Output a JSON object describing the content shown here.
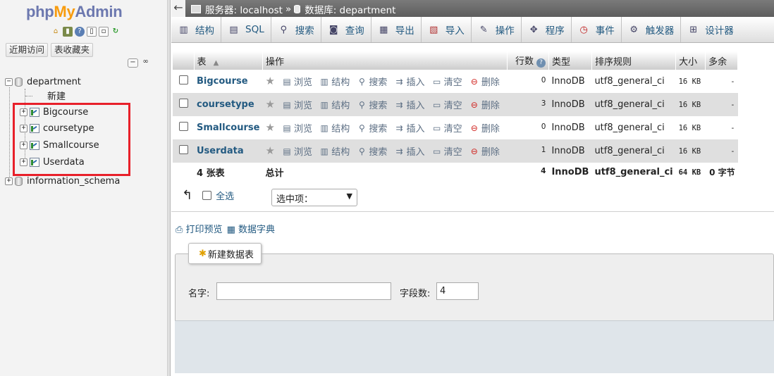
{
  "logo": {
    "php": "php",
    "my": "My",
    "admin": "Admin"
  },
  "sidebar": {
    "tab_recent": "近期访问",
    "tab_favorites": "表收藏夹",
    "tree": {
      "db1": "department",
      "new": "新建",
      "tables": [
        "Bigcourse",
        "coursetype",
        "Smallcourse",
        "Userdata"
      ],
      "db2": "information_schema"
    }
  },
  "breadcrumb": {
    "server": "服务器: localhost",
    "sep": "»",
    "database": "数据库: department"
  },
  "tabs": [
    "结构",
    "SQL",
    "搜索",
    "查询",
    "导出",
    "导入",
    "操作",
    "程序",
    "事件",
    "触发器",
    "设计器"
  ],
  "table": {
    "headers": {
      "table": "表",
      "action": "操作",
      "rows": "行数",
      "type": "类型",
      "collation": "排序规则",
      "size": "大小",
      "overhead": "多余"
    },
    "actions": {
      "browse": "浏览",
      "structure": "结构",
      "search": "搜索",
      "insert": "插入",
      "empty": "清空",
      "drop": "删除"
    },
    "rows": [
      {
        "name": "Bigcourse",
        "rows": "0",
        "type": "InnoDB",
        "collation": "utf8_general_ci",
        "size": "16 KB",
        "overhead": "-"
      },
      {
        "name": "coursetype",
        "rows": "3",
        "type": "InnoDB",
        "collation": "utf8_general_ci",
        "size": "16 KB",
        "overhead": "-"
      },
      {
        "name": "Smallcourse",
        "rows": "0",
        "type": "InnoDB",
        "collation": "utf8_general_ci",
        "size": "16 KB",
        "overhead": "-"
      },
      {
        "name": "Userdata",
        "rows": "1",
        "type": "InnoDB",
        "collation": "utf8_general_ci",
        "size": "16 KB",
        "overhead": "-"
      }
    ],
    "footer": {
      "count": "4 张表",
      "label": "总计",
      "rows": "4",
      "type": "InnoDB",
      "collation": "utf8_general_ci",
      "size": "64 KB",
      "overhead": "0 字节"
    }
  },
  "bulk": {
    "check_all": "全选",
    "with_selected": "选中项："
  },
  "links": {
    "print": "打印预览",
    "dictionary": "数据字典"
  },
  "create": {
    "legend": "新建数据表",
    "name_label": "名字:",
    "name_value": "",
    "fields_label": "字段数:",
    "fields_value": "4"
  }
}
